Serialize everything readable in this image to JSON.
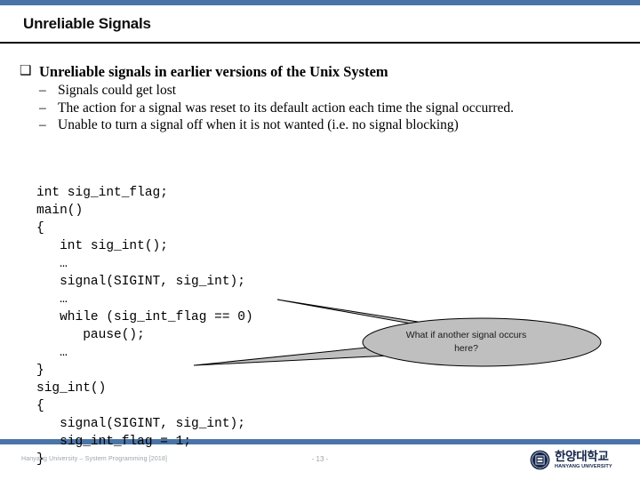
{
  "theme": {
    "accent_bar_color": "#4a74a8",
    "rule_color": "#000000",
    "callout_fill": "#bfbfbf",
    "callout_stroke": "#000000",
    "logo_color": "#14264a",
    "footer_text_color": "#9aa4ad"
  },
  "header": {
    "title": "Unreliable Signals"
  },
  "content": {
    "main_bullet": {
      "marker": "❑",
      "text": "Unreliable signals in earlier versions of the Unix System"
    },
    "sub_bullets": [
      {
        "marker": "–",
        "text": "Signals could get lost"
      },
      {
        "marker": "–",
        "text": "The action for a signal was reset to its default action each time the signal occurred."
      },
      {
        "marker": "–",
        "text": "Unable to turn a signal off when it is not wanted (i.e. no signal blocking)"
      }
    ],
    "code": "int sig_int_flag;\nmain()\n{\n   int sig_int();\n   …\n   signal(SIGINT, sig_int);\n   …\n   while (sig_int_flag == 0)\n      pause();\n   …\n}\nsig_int()\n{\n   signal(SIGINT, sig_int);\n   sig_int_flag = 1;\n}"
  },
  "callout": {
    "line1": "What if another signal occurs",
    "line2": "here?"
  },
  "footer": {
    "course": "Hanyang University – System Programming  [2018]",
    "page": "- 13 -",
    "logo_ko": "한양대학교",
    "logo_en": "HANYANG UNIVERSITY",
    "seal_label": "hanyang-seal"
  }
}
